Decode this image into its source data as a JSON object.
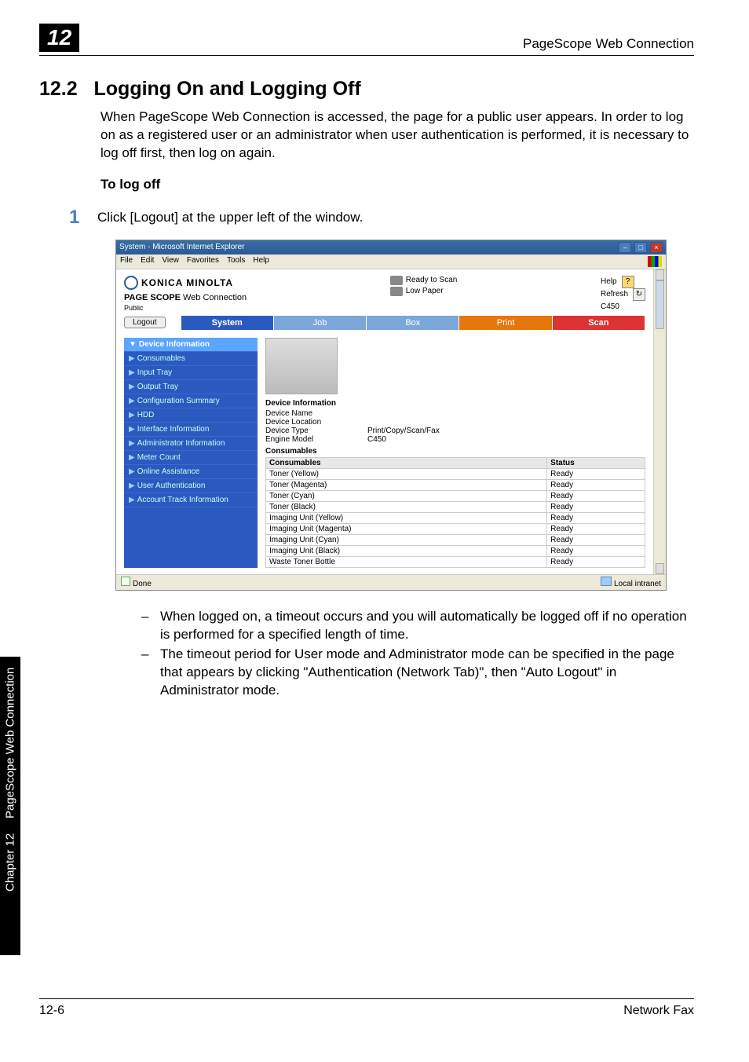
{
  "header": {
    "chapter_badge": "12",
    "title": "PageScope Web Connection"
  },
  "section": {
    "number": "12.2",
    "title": "Logging On and Logging Off",
    "intro": "When PageScope Web Connection is accessed, the page for a public user appears. In order to log on as a registered user or an administrator when user authentication is performed, it is necessary to log off first, then log on again.",
    "subheading": "To log off",
    "step_num": "1",
    "step_text": "Click [Logout] at the upper left of the window."
  },
  "screenshot": {
    "window_title": "System - Microsoft Internet Explorer",
    "menubar": [
      "File",
      "Edit",
      "View",
      "Favorites",
      "Tools",
      "Help"
    ],
    "brand": "KONICA MINOLTA",
    "connection_label": "Web Connection",
    "scope_label": "PAGE SCOPE",
    "user_mode": "Public",
    "status1_label": "Ready to Scan",
    "status2_label": "Low Paper",
    "right_links": {
      "help": "Help",
      "refresh": "Refresh",
      "model": "C450"
    },
    "logout_button": "Logout",
    "tabs": {
      "system": "System",
      "job": "Job",
      "box": "Box",
      "print": "Print",
      "scan": "Scan"
    },
    "side_items": [
      {
        "label": "Device Information",
        "active": true,
        "prefix": "▼"
      },
      {
        "label": "Consumables",
        "prefix": "▶"
      },
      {
        "label": "Input Tray",
        "prefix": "▶"
      },
      {
        "label": "Output Tray",
        "prefix": "▶"
      },
      {
        "label": "Configuration Summary",
        "prefix": "▶"
      },
      {
        "label": "HDD",
        "prefix": "▶"
      },
      {
        "label": "Interface Information",
        "prefix": "▶"
      },
      {
        "label": "Administrator Information",
        "prefix": "▶"
      },
      {
        "label": "Meter Count",
        "prefix": "▶"
      },
      {
        "label": "Online Assistance",
        "prefix": "▶"
      },
      {
        "label": "User Authentication",
        "prefix": "▶"
      },
      {
        "label": "Account Track Information",
        "prefix": "▶"
      }
    ],
    "dev_info_title": "Device Information",
    "dev_info": [
      {
        "k": "Device Name",
        "v": ""
      },
      {
        "k": "Device Location",
        "v": ""
      },
      {
        "k": "Device Type",
        "v": "Print/Copy/Scan/Fax"
      },
      {
        "k": "Engine Model",
        "v": "C450"
      }
    ],
    "consumables_title": "Consumables",
    "table_headers": {
      "c1": "Consumables",
      "c2": "Status"
    },
    "table_rows": [
      {
        "name": "Toner (Yellow)",
        "status": "Ready"
      },
      {
        "name": "Toner (Magenta)",
        "status": "Ready"
      },
      {
        "name": "Toner (Cyan)",
        "status": "Ready"
      },
      {
        "name": "Toner (Black)",
        "status": "Ready"
      },
      {
        "name": "Imaging Unit (Yellow)",
        "status": "Ready"
      },
      {
        "name": "Imaging Unit (Magenta)",
        "status": "Ready"
      },
      {
        "name": "Imaging Unit (Cyan)",
        "status": "Ready"
      },
      {
        "name": "Imaging Unit (Black)",
        "status": "Ready"
      },
      {
        "name": "Waste Toner Bottle",
        "status": "Ready"
      }
    ],
    "statusbar_done": "Done",
    "statusbar_zone": "Local intranet"
  },
  "bullets": [
    "When logged on, a timeout occurs and you will automatically be logged off if no operation is performed for a specified length of time.",
    "The timeout period for User mode and Administrator mode can be specified in the page that appears by clicking \"Authentication (Network Tab)\", then \"Auto Logout\" in Administrator mode."
  ],
  "side_tab": {
    "line1": "PageScope Web Connection",
    "line2": "Chapter 12"
  },
  "footer": {
    "left": "12-6",
    "right": "Network Fax"
  }
}
